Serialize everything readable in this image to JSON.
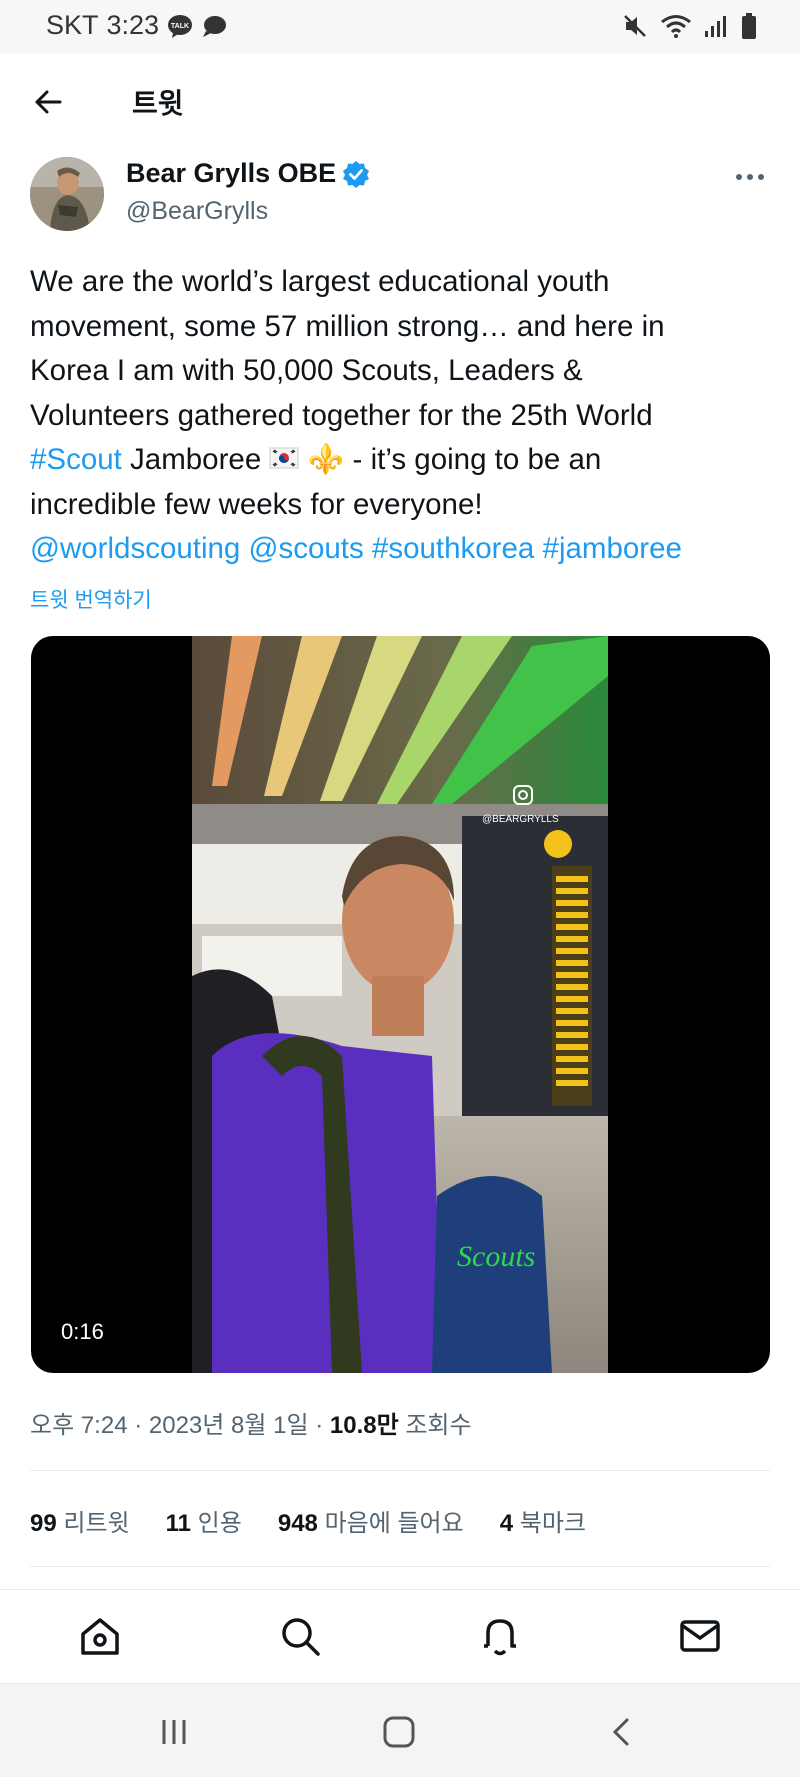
{
  "status_bar": {
    "carrier": "SKT",
    "time": "3:23",
    "left_icons": [
      "talk-icon",
      "chat-bubble-icon"
    ],
    "right_icons": [
      "mute-icon",
      "wifi-icon",
      "signal-icon",
      "battery-icon"
    ]
  },
  "header": {
    "title": "트윗",
    "back_icon": "arrow-left-icon"
  },
  "tweet": {
    "author_name": "Bear Grylls OBE",
    "author_handle": "@BearGrylls",
    "verified": true,
    "lines": [
      "We are the world’s largest educational youth",
      "movement, some 57 million strong… and here in",
      "Korea I am with 50,000 Scouts, Leaders &",
      "Volunteers gathered together for the 25th World"
    ],
    "hashtag_scout": "#Scout",
    "jamboree_word": " Jamboree ",
    "fleur_emoji": "⚜️",
    "after_emoji": " - it’s going to be an",
    "line6": "incredible few weeks for everyone!",
    "tags": [
      "@worldscouting",
      "@scouts",
      "#southkorea",
      "#jamboree"
    ],
    "translate": "트윗 번역하기"
  },
  "media": {
    "duration": "0:16",
    "watermark": "@BEARGRYLLS",
    "shirt_text": "Scouts"
  },
  "meta": {
    "time": "오후 7:24",
    "date": "2023년 8월 1일",
    "views_count": "10.8만",
    "views_label": "조회수"
  },
  "stats": [
    {
      "count": "99",
      "label": "리트윗"
    },
    {
      "count": "11",
      "label": "인용"
    },
    {
      "count": "948",
      "label": "마음에 들어요"
    },
    {
      "count": "4",
      "label": "북마크"
    }
  ],
  "tabbar": [
    "home-icon",
    "search-icon",
    "notifications-icon",
    "messages-icon"
  ],
  "navbar": [
    "recent-apps-icon",
    "home-button-icon",
    "back-icon"
  ],
  "colors": {
    "accent": "#1d9bf0",
    "text": "#0f1419",
    "secondary": "#536471",
    "shirt": "#5a2fbf"
  }
}
